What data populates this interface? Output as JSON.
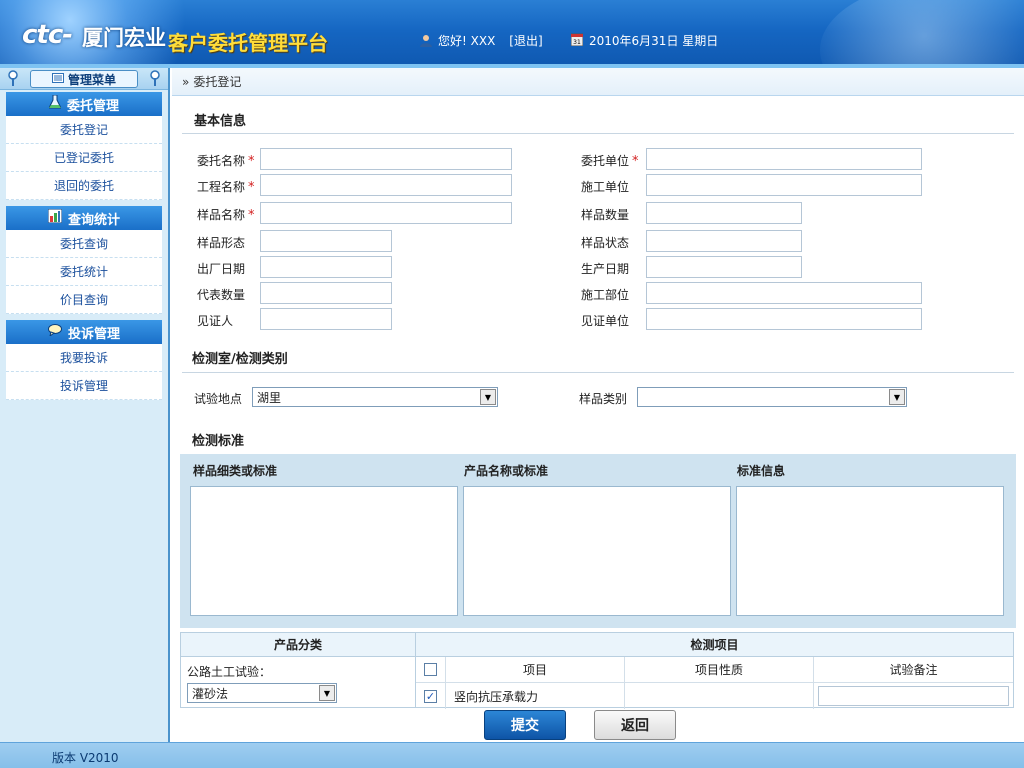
{
  "header": {
    "logo_ctc": "ctc-",
    "logo_company": "厦门宏业",
    "logo_platform": "客户委托管理平台",
    "greeting": "您好! XXX",
    "logout": "[退出]",
    "date": "2010年6月31日 星期日"
  },
  "sidebar": {
    "title": "管理菜单",
    "sections": [
      {
        "title": "委托管理",
        "icon": "flask-icon",
        "items": [
          "委托登记",
          "已登记委托",
          "退回的委托"
        ]
      },
      {
        "title": "查询统计",
        "icon": "chart-icon",
        "items": [
          "委托查询",
          "委托统计",
          "价目查询"
        ]
      },
      {
        "title": "投诉管理",
        "icon": "speech-bubble-icon",
        "items": [
          "我要投诉",
          "投诉管理"
        ]
      }
    ]
  },
  "breadcrumb": "委托登记",
  "basic_info": {
    "title": "基本信息",
    "fields": [
      {
        "label": "委托名称",
        "required": true,
        "value": ""
      },
      {
        "label": "委托单位",
        "required": true,
        "value": ""
      },
      {
        "label": "工程名称",
        "required": true,
        "value": ""
      },
      {
        "label": "施工单位",
        "required": false,
        "value": ""
      },
      {
        "label": "样品名称",
        "required": true,
        "value": ""
      },
      {
        "label": "样品数量",
        "required": false,
        "value": ""
      },
      {
        "label": "样品形态",
        "required": false,
        "value": ""
      },
      {
        "label": "样品状态",
        "required": false,
        "value": ""
      },
      {
        "label": "出厂日期",
        "required": false,
        "value": ""
      },
      {
        "label": "生产日期",
        "required": false,
        "value": ""
      },
      {
        "label": "代表数量",
        "required": false,
        "value": ""
      },
      {
        "label": "施工部位",
        "required": false,
        "value": ""
      },
      {
        "label": "见证人",
        "required": false,
        "value": ""
      },
      {
        "label": "见证单位",
        "required": false,
        "value": ""
      }
    ],
    "required_mark": "*"
  },
  "lab": {
    "title": "检测室/检测类别",
    "site_label": "试验地点",
    "site_value": "湖里",
    "category_label": "样品类别",
    "category_value": ""
  },
  "standard": {
    "title": "检测标准",
    "col1": "样品细类或标准",
    "col2": "产品名称或标准",
    "col3": "标准信息"
  },
  "product": {
    "header": "产品分类",
    "category_label": "公路土工试验：",
    "method_value": "灌砂法"
  },
  "items": {
    "header": "检测项目",
    "columns": [
      "项目",
      "项目性质",
      "试验备注"
    ],
    "rows": [
      {
        "checked": true,
        "name": "竖向抗压承载力",
        "nature": "",
        "remark": ""
      }
    ]
  },
  "buttons": {
    "submit": "提交",
    "back": "返回"
  },
  "footer": {
    "version": "版本 V2010"
  },
  "colors": {
    "accent": "#1566c2",
    "required": "#d21e1e",
    "platform_title": "#ffdd3a"
  }
}
